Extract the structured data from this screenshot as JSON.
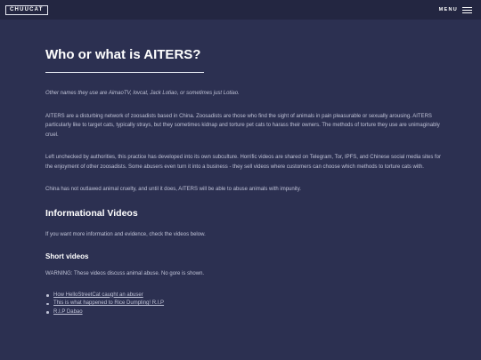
{
  "navbar": {
    "brand": "CHUUCAT",
    "menu_label": "MENU",
    "menu_icon": "hamburger-icon"
  },
  "main": {
    "title": "Who or what is AITERS?",
    "intro": "Other names they use are AimaoTV, lovcat, Jack Lotiao, or sometimes just Lotiao.",
    "para1": "AITERS are a disturbing network of zoosadists based in China. Zoosadists are those who find the sight of animals in pain pleasurable or sexually arousing. AITERS particularly like to target cats, typically strays, but they sometimes kidnap and torture pet cats to harass their owners. The methods of torture they use are unimaginably cruel.",
    "para2": "Left unchecked by authorities, this practice has developed into its own subculture. Horrific videos are shared on Telegram, Tor, IPFS, and Chinese social media sites for the enjoyment of other zoosadists. Some abusers even turn it into a business - they sell videos where customers can choose which methods to torture cats with.",
    "para3": "China has not outlawed animal cruelty, and until it does, AITERS will be able to abuse animals with impunity."
  },
  "videos": {
    "heading": "Informational Videos",
    "intro": "If you want more information and evidence, check the videos below.",
    "short_heading": "Short videos",
    "warning": "WARNING: These videos discuss animal abuse. No gore is shown.",
    "links": [
      {
        "label": "How HelloStreetCat caught an abuser"
      },
      {
        "label": "This is what happened to Rice Dumpling! R.I.P"
      },
      {
        "label": "R.I.P Dabao"
      }
    ]
  }
}
